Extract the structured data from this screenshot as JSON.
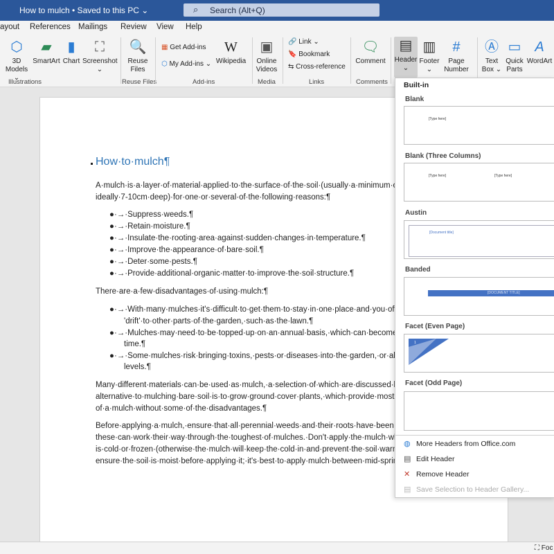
{
  "window": {
    "title": "How to mulch • Saved to this PC ⌄",
    "search_placeholder": "Search (Alt+Q)"
  },
  "tabs": [
    "ayout",
    "References",
    "Mailings",
    "Review",
    "View",
    "Help"
  ],
  "ribbon": {
    "illustrations": {
      "models": "3D Models ⌄",
      "models_l1": "3D",
      "models_l2": "Models ⌄",
      "smartart": "SmartArt",
      "chart": "Chart",
      "screenshot": "Screenshot",
      "screenshot_caret": "⌄",
      "label": "Illustrations"
    },
    "reuse": {
      "btn_l1": "Reuse",
      "btn_l2": "Files",
      "label": "Reuse Files"
    },
    "addins": {
      "get": "Get Add-ins",
      "my": "My Add-ins",
      "wiki": "Wikipedia",
      "label": "Add-ins"
    },
    "media": {
      "l1": "Online",
      "l2": "Videos",
      "label": "Media"
    },
    "links": {
      "link": "Link",
      "bookmark": "Bookmark",
      "crossref": "Cross-reference",
      "label": "Links"
    },
    "comments": {
      "comment": "Comment",
      "label": "Comments"
    },
    "headerfooter": {
      "header": "Header",
      "header_caret": "⌄",
      "footer": "Footer",
      "footer_caret": "⌄",
      "page_l1": "Page",
      "page_l2": "Number ⌄"
    },
    "text": {
      "textbox_l1": "Text",
      "textbox_l2": "Box ⌄",
      "quick_l1": "Quick",
      "quick_l2": "Parts ⌄",
      "wordart": "WordArt"
    }
  },
  "document": {
    "heading": "How·to·mulch¶",
    "p1_l1": "A·mulch·is·a·layer·of·material·applied·to·the·surface·of·the·soil·(usually·a·minimum·of·",
    "p1_l2": "ideally·7-10cm·deep)·for·one·or·several·of·the·following·reasons:¶",
    "reasons": [
      "Suppress·weeds.¶",
      "Retain·moisture.¶",
      "Insulate·the·rooting·area·against·sudden·changes·in·temperature.¶",
      "Improve·the·appearance·of·bare·soil.¶",
      "Deter·some·pests.¶",
      "Provide·additional·organic·matter·to·improve·the·soil·structure.¶"
    ],
    "p2": "There·are·a·few·disadvantages·of·using·mulch:¶",
    "dis1_l1": "With·many·mulches·it's·difficult·to·get·them·to·stay·in·one·place·and·you·ofte",
    "dis1_l2": "'drift'·to·other·parts·of·the·garden,·such·as·the·lawn.¶",
    "dis2_l1": "Mulches·may·need·to·be·topped·up·on·an·annual·basis,·which·can·become·ex",
    "dis2_l2": "time.¶",
    "dis3_l1": "Some·mulches·risk·bringing·toxins,·pests·or·diseases·into·the·garden,·or·alteri",
    "dis3_l2": "levels.¶",
    "p3_l1": "Many·different·materials·can·be·used·as·mulch,·a·selection·of·which·are·discussed·bel",
    "p3_l2": "alternative·to·mulching·bare·soil·is·to·grow·ground·cover·plants,·which·provide·most·",
    "p3_l3": "of·a·mulch·without·some·of·the·disadvantages.¶",
    "p4_l1": "Before·applying·a·mulch,·ensure·that·all·perennial·weeds·and·their·roots·have·been·re",
    "p4_l2": "these·can·work·their·way·through·the·toughest·of·mulches.·Don't·apply·the·mulch·wh",
    "p4_l3": "is·cold·or·frozen·(otherwise·the·mulch·will·keep·the·cold·in·and·prevent·the·soil·warm",
    "p4_l4": "ensure·the·soil·is·moist·before·applying·it;·it's·best·to·apply·mulch·between·mid-sprin"
  },
  "gallery": {
    "section": "Built-in",
    "items": [
      {
        "title": "Blank",
        "placeholder": "[Type here]"
      },
      {
        "title": "Blank (Three Columns)",
        "placeholder": "[Type here]",
        "placeholder2": "[Type here]"
      },
      {
        "title": "Austin",
        "placeholder": "[Document title]"
      },
      {
        "title": "Banded",
        "placeholder": "[DOCUMENT TITLE]"
      },
      {
        "title": "Facet (Even Page)",
        "placeholder": "1"
      },
      {
        "title": "Facet (Odd Page)"
      }
    ],
    "menu": [
      {
        "label": "More Headers from Office.com",
        "enabled": true
      },
      {
        "label": "Edit Header",
        "enabled": true
      },
      {
        "label": "Remove Header",
        "enabled": true
      },
      {
        "label": "Save Selection to Header Gallery...",
        "enabled": false
      }
    ]
  },
  "status": {
    "right": "Foc"
  },
  "colors": {
    "titlebar": "#2b579a",
    "heading": "#2e74b5",
    "accent": "#4472c4"
  }
}
